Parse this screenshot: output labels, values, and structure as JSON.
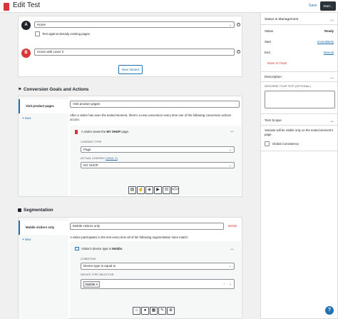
{
  "header": {
    "title": "Edit Test",
    "save_label": "Save",
    "start_label": "Start..."
  },
  "variants": {
    "a": {
      "letter": "A",
      "value": "Home",
      "color": "#1d2327"
    },
    "against_existing": "Test against already existing pages",
    "b": {
      "letter": "B",
      "value": "Home with cover 2",
      "color": "#d63638"
    },
    "new_variant": "New Variant"
  },
  "goals": {
    "section_title": "Conversion Goals and Actions",
    "tab_label": "Visit product pages",
    "tab_input": "Visit product pages",
    "new_label": "New",
    "description": "After a visitor has seen the tested element, there's a new conversion every time one of the following conversion actions occurs:",
    "action_prefix": "A visitor views the",
    "action_bold": "MY SHOP",
    "action_suffix": "page.",
    "content_type_label": "CONTENT TYPE",
    "content_type_value": "Page",
    "actual_content_label": "ACTUAL CONTENT",
    "view_link": "(VIEW ↗)",
    "actual_content_value": "MY SHOP"
  },
  "segmentation": {
    "section_title": "Segmentation",
    "tab_label": "Mobile visitors only",
    "tab_input": "Mobile visitors only",
    "delete_label": "Delete",
    "new_label": "New",
    "description": "A visitor participates in the test every time all of the following segmentation rules match:",
    "rule_prefix": "Visitor's device type is",
    "rule_bold": "Mobile.",
    "condition_label": "CONDITION",
    "condition_value": "Device type is equal to",
    "device_label": "DEVICE TYPE SELECTOR",
    "device_tag": "Mobile"
  },
  "sidebar": {
    "status": {
      "title": "Status & Management",
      "status_label": "Status",
      "status_value": "Ready",
      "start_label": "Start",
      "start_value": "Immediately",
      "end_label": "End",
      "end_value": "Manual",
      "trash": "Move to Trash"
    },
    "description": {
      "title": "Description",
      "field_label": "DESCRIBE YOUR TEST (OPTIONAL)"
    },
    "scope": {
      "title": "Test Scope",
      "text": "Variants will be visible only on the tested element's page.",
      "global": "Global Consistency"
    }
  },
  "colors": {
    "accent": "#2271b1",
    "danger": "#d63638",
    "dark": "#1d2327"
  }
}
